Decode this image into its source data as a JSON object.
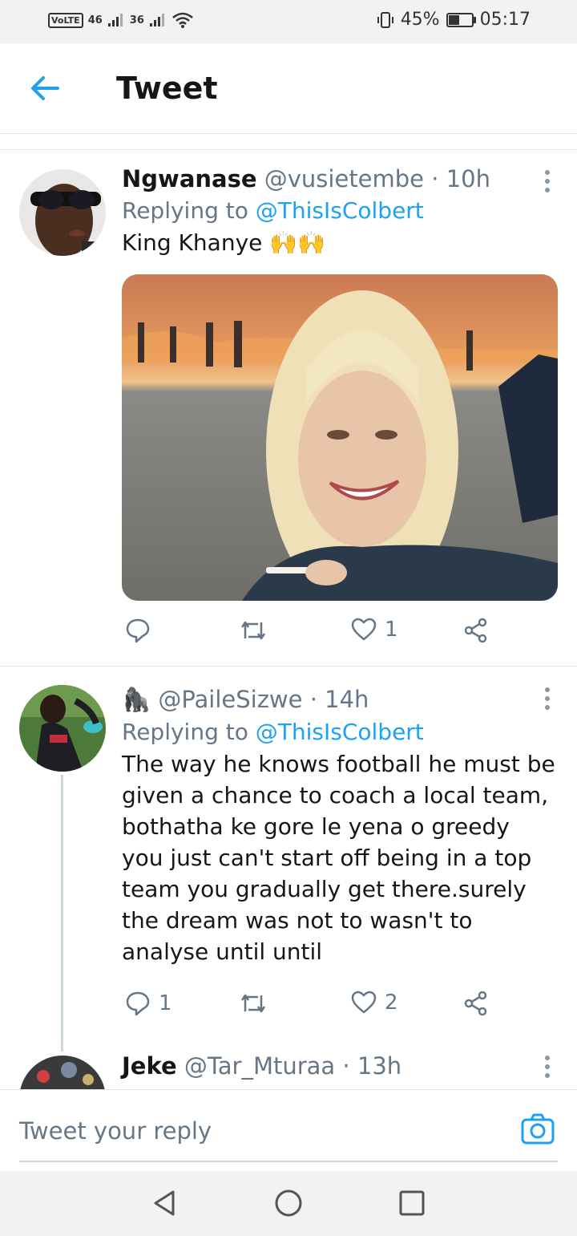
{
  "status_bar": {
    "volte": "VoLTE",
    "sim1_net": "46",
    "sim2_net": "36",
    "battery_pct": "45%",
    "time": "05:17"
  },
  "header": {
    "title": "Tweet"
  },
  "tweets": [
    {
      "name": "Ngwanase",
      "handle": "@vusietembe",
      "time": "10h",
      "reply_prefix": "Replying to",
      "reply_to": "@ThisIsColbert",
      "text": "King Khanye 🙌🙌",
      "reply_count": "",
      "retweet_count": "",
      "like_count": "1"
    },
    {
      "name": "🦍",
      "handle": "@PaileSizwe",
      "time": "14h",
      "reply_prefix": "Replying to",
      "reply_to": "@ThisIsColbert",
      "text": "The way he knows football he must be given a chance to coach a local team, bothatha ke gore le yena o greedy you just can't start off being in a top team you gradually get there.surely the dream was not to wasn't to analyse until until",
      "reply_count": "1",
      "retweet_count": "",
      "like_count": "2"
    },
    {
      "name": "Jeke",
      "handle": "@Tar_Mturaa",
      "time": "13h"
    }
  ],
  "reply_box": {
    "placeholder": "Tweet your reply"
  },
  "colors": {
    "accent": "#1da1f2",
    "muted": "#657786"
  }
}
